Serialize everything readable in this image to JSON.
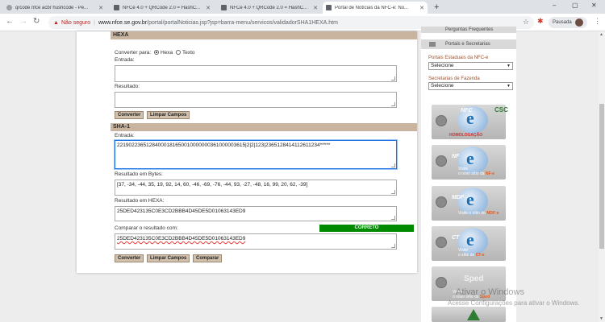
{
  "tabs": [
    {
      "title": "qrcode nfce acbr hushcode - Pe..."
    },
    {
      "title": "NFCe 4.0 + QRCode 2.0 = HashC..."
    },
    {
      "title": "NFCe 4.0 + QRCode 2.0 = HashC..."
    },
    {
      "title": "Portal de Notícias da NFC-e: No..."
    }
  ],
  "window_controls": [
    "–",
    "▢",
    "✕"
  ],
  "address_bar": {
    "warning": "Não seguro",
    "url_host": "www.nfce.se.gov.br",
    "url_path": "/portal/portalNoticias.jsp?jsp=barra-menu/servicos/validadorSHA1HEXA.htm"
  },
  "profile": {
    "label": "Pausada"
  },
  "hexa": {
    "title": "HEXA",
    "convert_label": "Converter para:",
    "option_hexa": "Hexa",
    "option_texto": "Texto",
    "input_label": "Entrada:",
    "input_value": "",
    "result_label": "Resultado:",
    "result_value": "",
    "btn_convert": "Converter",
    "btn_clear": "Limpar Campos"
  },
  "sha1": {
    "title": "SHA-1",
    "input_label": "Entrada:",
    "input_value": "22190223651284000181650010000000361000003615|2|2|123|2365128414112611234*****",
    "bytes_label": "Resultado em Bytes:",
    "bytes_value": "[37, -34, -44, 35, 19, 92, 14, 60, -46, -69, -76, -44, 93, -27, -48, 16, 99, 20, 62, -39]",
    "hexa_label": "Resultado em HEXA:",
    "hexa_value": "25DED423135C0E3CD2BBB4D45DE5D01063143ED9",
    "compare_label": "Comparar o resultado com:",
    "compare_value": "25DED423135C0E3CD2BBB4D45DE5D01063143ED9",
    "status": "CORRETO",
    "btn_convert": "Converter",
    "btn_clear": "Limpar Campos",
    "btn_compare": "Comparar"
  },
  "sidebar": {
    "link_faq": "Perguntas Frequentes",
    "link_portals": "Portais e Secretarias",
    "state_portals_label": "Portais Estaduais da NFC-e",
    "state_portals_selected": "Selecione",
    "secretarias_label": "Secretarias de Fazenda",
    "secretarias_selected": "Selecione",
    "banners": [
      {
        "logo": "e",
        "title": "NFC",
        "extra": "CSC",
        "note": "HOMOLOGAÇÃO"
      },
      {
        "logo": "e",
        "title": "NF",
        "line1": "Visite",
        "line2": "o novo sítio da ",
        "highlight": "NF-e"
      },
      {
        "logo": "e",
        "title": "MDF",
        "line1": "Visite o sítio do ",
        "highlight": "MDF-e"
      },
      {
        "logo": "e",
        "title": "CT",
        "line1": "Visite",
        "line2": "o sítio do ",
        "highlight": "CT-e"
      },
      {
        "logo": "Sped",
        "line1": "Visite",
        "line2": "o novo sítio do ",
        "highlight": "Sped"
      }
    ]
  },
  "watermark": {
    "line1": "Ativar o Windows",
    "line2": "Acesse Configurações para ativar o Windows."
  }
}
